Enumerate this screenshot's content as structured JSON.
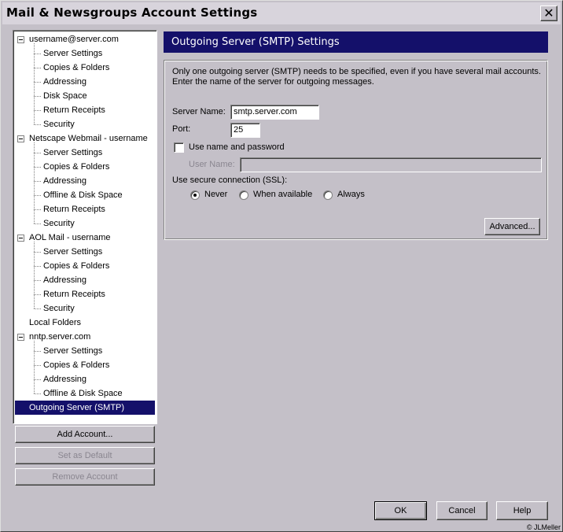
{
  "window": {
    "title": "Mail & Newsgroups Account Settings",
    "close_glyph": "✕"
  },
  "tree": [
    {
      "label": "username@server.com",
      "level": 0,
      "expanded": true
    },
    {
      "label": "Server Settings",
      "level": 1
    },
    {
      "label": "Copies & Folders",
      "level": 1
    },
    {
      "label": "Addressing",
      "level": 1
    },
    {
      "label": "Disk Space",
      "level": 1
    },
    {
      "label": "Return Receipts",
      "level": 1
    },
    {
      "label": "Security",
      "level": 1
    },
    {
      "label": "Netscape Webmail - username",
      "level": 0,
      "expanded": true
    },
    {
      "label": "Server Settings",
      "level": 1
    },
    {
      "label": "Copies & Folders",
      "level": 1
    },
    {
      "label": "Addressing",
      "level": 1
    },
    {
      "label": "Offline & Disk Space",
      "level": 1
    },
    {
      "label": "Return Receipts",
      "level": 1
    },
    {
      "label": "Security",
      "level": 1
    },
    {
      "label": "AOL Mail - username",
      "level": 0,
      "expanded": true
    },
    {
      "label": "Server Settings",
      "level": 1
    },
    {
      "label": "Copies & Folders",
      "level": 1
    },
    {
      "label": "Addressing",
      "level": 1
    },
    {
      "label": "Return Receipts",
      "level": 1
    },
    {
      "label": "Security",
      "level": 1
    },
    {
      "label": "Local Folders",
      "level": 0,
      "expanded": false
    },
    {
      "label": "nntp.server.com",
      "level": 0,
      "expanded": true
    },
    {
      "label": "Server Settings",
      "level": 1
    },
    {
      "label": "Copies & Folders",
      "level": 1
    },
    {
      "label": "Addressing",
      "level": 1
    },
    {
      "label": "Offline & Disk Space",
      "level": 1
    },
    {
      "label": "Outgoing Server (SMTP)",
      "level": 0,
      "selected": true
    }
  ],
  "left_buttons": {
    "add_account": "Add Account...",
    "set_default": "Set as Default",
    "remove_account": "Remove Account"
  },
  "panel": {
    "header": "Outgoing Server (SMTP) Settings",
    "description": "Only one outgoing server (SMTP) needs to be specified, even if you have several mail accounts. Enter the name of the server for outgoing messages.",
    "server_name_label": "Server Name:",
    "server_name_value": "smtp.server.com",
    "port_label": "Port:",
    "port_value": "25",
    "use_auth_label": "Use name and password",
    "use_auth_checked": false,
    "user_name_label": "User Name:",
    "user_name_value": "",
    "ssl_label": "Use secure connection (SSL):",
    "ssl_options": [
      "Never",
      "When available",
      "Always"
    ],
    "ssl_selected": "Never",
    "advanced_button": "Advanced..."
  },
  "footer": {
    "ok": "OK",
    "cancel": "Cancel",
    "help": "Help",
    "copyright": "© JLMeller"
  }
}
